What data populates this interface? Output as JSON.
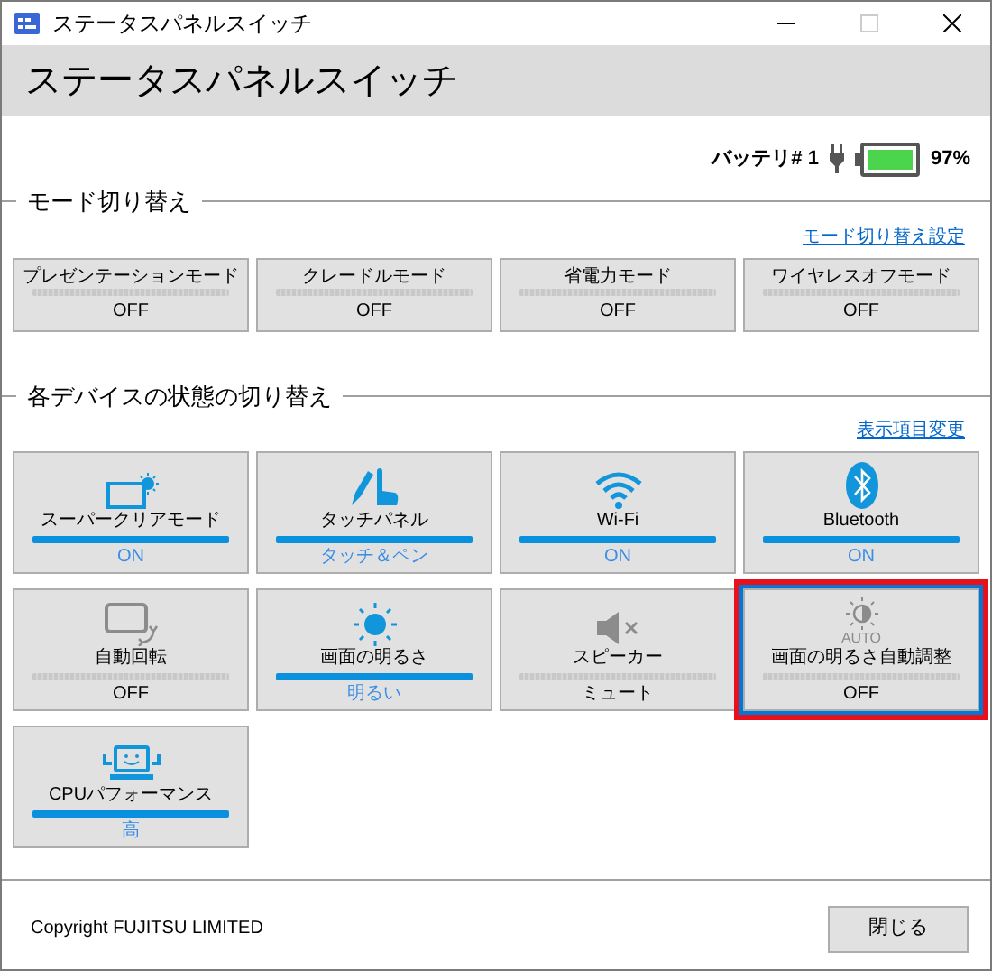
{
  "window": {
    "title": "ステータスパネルスイッチ"
  },
  "header": {
    "title": "ステータスパネルスイッチ"
  },
  "battery": {
    "label": "バッテリ# 1",
    "charging": true,
    "percent": "97%"
  },
  "mode_section": {
    "title": "モード切り替え",
    "link": "モード切り替え設定",
    "tiles": [
      {
        "label": "プレゼンテーションモード",
        "status": "OFF",
        "on": false
      },
      {
        "label": "クレードルモード",
        "status": "OFF",
        "on": false
      },
      {
        "label": "省電力モード",
        "status": "OFF",
        "on": false
      },
      {
        "label": "ワイヤレスオフモード",
        "status": "OFF",
        "on": false
      }
    ]
  },
  "device_section": {
    "title": "各デバイスの状態の切り替え",
    "link": "表示項目変更",
    "tiles": [
      {
        "kind": "super-clear",
        "label": "スーパークリアモード",
        "status": "ON",
        "on": true,
        "highlighted": false
      },
      {
        "kind": "touch",
        "label": "タッチパネル",
        "status": "タッチ＆ペン",
        "on": true,
        "highlighted": false
      },
      {
        "kind": "wifi",
        "label": "Wi-Fi",
        "status": "ON",
        "on": true,
        "highlighted": false
      },
      {
        "kind": "bluetooth",
        "label": "Bluetooth",
        "status": "ON",
        "on": true,
        "highlighted": false
      },
      {
        "kind": "rotation",
        "label": "自動回転",
        "status": "OFF",
        "on": false,
        "highlighted": false
      },
      {
        "kind": "brightness",
        "label": "画面の明るさ",
        "status": "明るい",
        "on": true,
        "highlighted": false
      },
      {
        "kind": "speaker",
        "label": "スピーカー",
        "status": "ミュート",
        "on": false,
        "highlighted": false
      },
      {
        "kind": "auto-brightness",
        "icon_caption": "AUTO",
        "label": "画面の明るさ自動調整",
        "status": "OFF",
        "on": false,
        "highlighted": true
      },
      {
        "kind": "cpu",
        "label": "CPUパフォーマンス",
        "status": "高",
        "on": true,
        "highlighted": false
      }
    ]
  },
  "footer": {
    "copyright": "Copyright FUJITSU LIMITED",
    "close_button": "閉じる"
  }
}
